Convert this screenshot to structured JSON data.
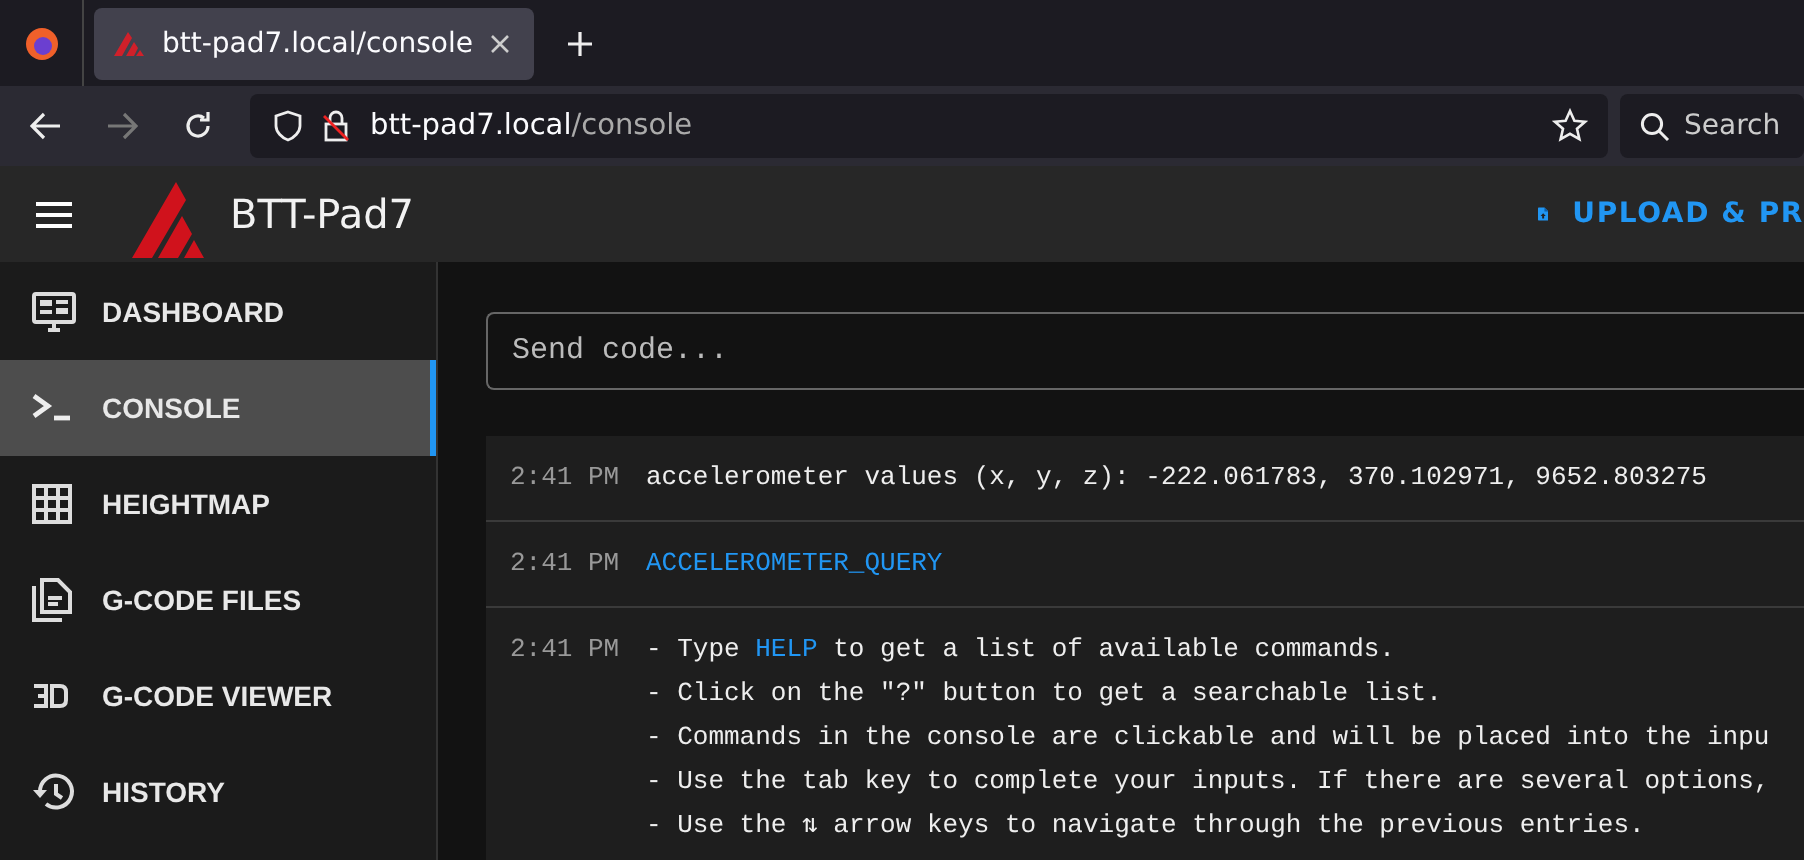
{
  "browser": {
    "tab": {
      "title": "btt-pad7.local/console",
      "selected": true
    },
    "url_host": "btt-pad7.local",
    "url_path": "/console",
    "search_label": "Search"
  },
  "app_bar": {
    "title": "BTT-Pad7",
    "upload_label": "UPLOAD & PR"
  },
  "sidebar": {
    "items": [
      {
        "label": "DASHBOARD",
        "kind": "monitor",
        "selected": false
      },
      {
        "label": "CONSOLE",
        "kind": "console",
        "selected": true
      },
      {
        "label": "HEIGHTMAP",
        "kind": "grid",
        "selected": false
      },
      {
        "label": "G-CODE FILES",
        "kind": "files",
        "selected": false
      },
      {
        "label": "G-CODE VIEWER",
        "kind": "viewer",
        "selected": false
      },
      {
        "label": "HISTORY",
        "kind": "history",
        "selected": false
      }
    ]
  },
  "console": {
    "placeholder": "Send code...",
    "entries": [
      {
        "time": "2:41 PM",
        "lines": [
          [
            {
              "kind": "text",
              "text": "accelerometer values (x, y, z): -222.061783, 370.102971, 9652.803275"
            }
          ]
        ]
      },
      {
        "time": "2:41 PM",
        "lines": [
          [
            {
              "kind": "command",
              "text": "ACCELEROMETER_QUERY"
            }
          ]
        ]
      },
      {
        "time": "2:41 PM",
        "lines": [
          [
            {
              "kind": "text",
              "text": "- Type "
            },
            {
              "kind": "command",
              "text": "HELP"
            },
            {
              "kind": "text",
              "text": " to get a list of available commands."
            }
          ],
          [
            {
              "kind": "text",
              "text": "- Click on the \"?\" button to get a searchable list."
            }
          ],
          [
            {
              "kind": "text",
              "text": "- Commands in the console are clickable and will be placed into the inpu"
            }
          ],
          [
            {
              "kind": "text",
              "text": "- Use the tab key to complete your inputs. If there are several options,"
            }
          ],
          [
            {
              "kind": "text",
              "text": "- Use the ⇅ arrow keys to navigate through the previous entries."
            }
          ]
        ]
      }
    ]
  }
}
